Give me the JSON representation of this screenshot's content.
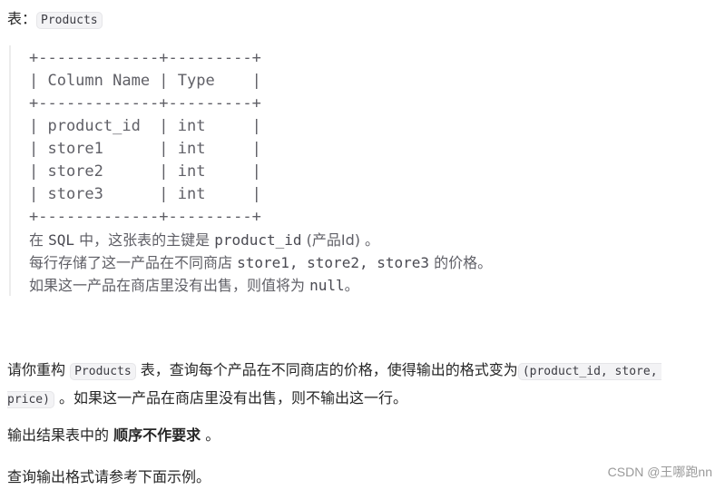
{
  "table_label": {
    "prefix": "表：",
    "name": "Products"
  },
  "schema": {
    "border": "+-------------+---------+",
    "header": "| Column Name | Type    |",
    "rows": [
      "| product_id  | int     |",
      "| store1      | int     |",
      "| store2      | int     |",
      "| store3      | int     |"
    ],
    "columns": [
      "Column Name",
      "Type"
    ],
    "data": [
      [
        "product_id",
        "int"
      ],
      [
        "store1",
        "int"
      ],
      [
        "store2",
        "int"
      ],
      [
        "store3",
        "int"
      ]
    ]
  },
  "schema_notes": {
    "line1_a": "在 ",
    "line1_sql": "SQL",
    "line1_b": " 中，这张表的主键是 ",
    "line1_key": "product_id",
    "line1_c": " (产品Id) 。",
    "line2_a": "每行存储了这一产品在不同商店 ",
    "line2_stores": "store1, store2, store3",
    "line2_b": " 的价格。",
    "line3_a": "如果这一产品在商店里没有出售，则值将为 ",
    "line3_null": "null",
    "line3_b": "。"
  },
  "task": {
    "p1_a": "请你重构 ",
    "p1_table": "Products",
    "p1_b": " 表，查询每个产品在不同商店的价格，使得输出的格式变为",
    "p1_format_part1": "(product_id, store,",
    "p1_format_part2": "price)",
    "p1_c": " 。如果这一产品在商店里没有出售，则不输出这一行。",
    "p2_a": "输出结果表中的 ",
    "p2_bold": "顺序不作要求",
    "p2_b": " 。",
    "p3": "查询输出格式请参考下面示例。"
  },
  "watermark": "CSDN @王哪跑nn"
}
